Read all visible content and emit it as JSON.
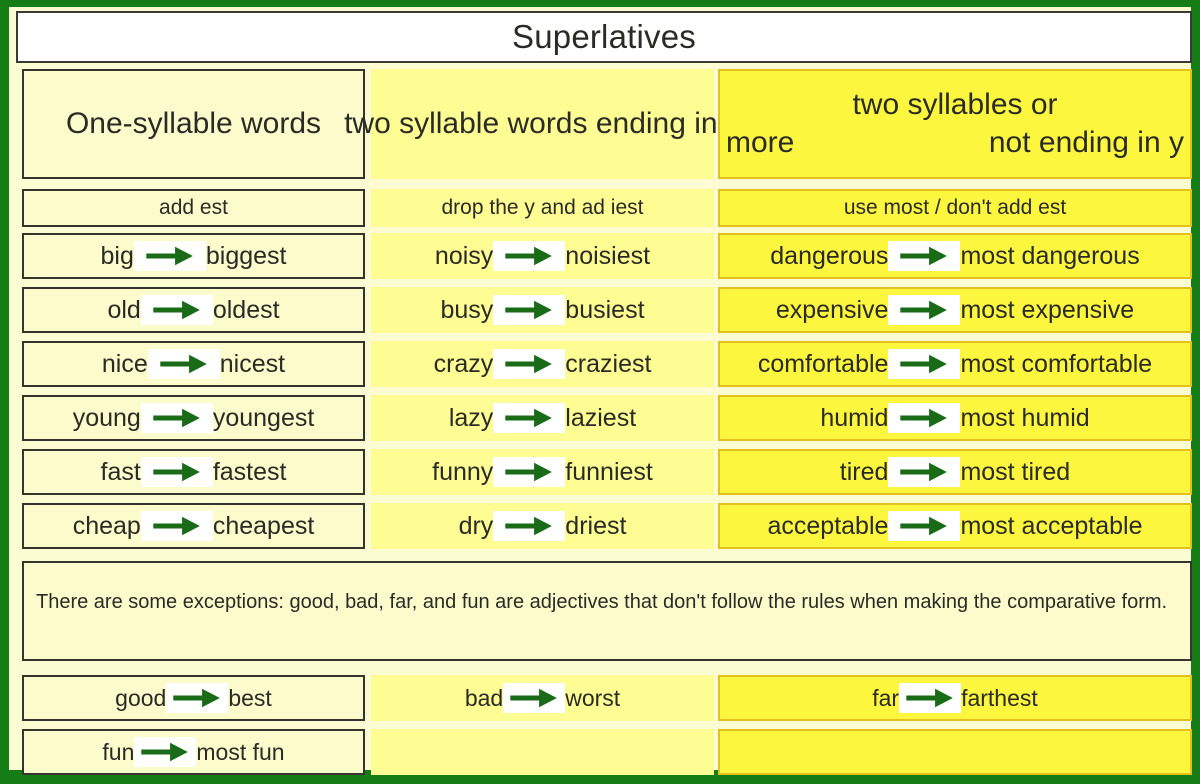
{
  "title": "Superlatives",
  "columns": [
    {
      "header": "One-syllable words",
      "rule": "add est"
    },
    {
      "header": "two syllable words ending in y",
      "rule": "drop the y and ad iest"
    },
    {
      "header_line1": "two syllables or",
      "header_line2_left": "more",
      "header_line2_right": "not ending in y",
      "rule": "use most / don't add est"
    }
  ],
  "rows": [
    {
      "col1": {
        "base": "big",
        "super": "biggest"
      },
      "col2": {
        "base": "noisy",
        "super": "noisiest"
      },
      "col3": {
        "base": "dangerous",
        "super": "most dangerous"
      }
    },
    {
      "col1": {
        "base": "old",
        "super": "oldest"
      },
      "col2": {
        "base": "busy",
        "super": "busiest"
      },
      "col3": {
        "base": "expensive",
        "super": "most expensive"
      }
    },
    {
      "col1": {
        "base": "nice",
        "super": "nicest"
      },
      "col2": {
        "base": "crazy",
        "super": "craziest"
      },
      "col3": {
        "base": "comfortable",
        "super": "most comfortable"
      }
    },
    {
      "col1": {
        "base": "young",
        "super": "youngest"
      },
      "col2": {
        "base": "lazy",
        "super": "laziest"
      },
      "col3": {
        "base": "humid",
        "super": "most humid"
      }
    },
    {
      "col1": {
        "base": "fast",
        "super": "fastest"
      },
      "col2": {
        "base": "funny",
        "super": "funniest"
      },
      "col3": {
        "base": "tired",
        "super": "most tired"
      }
    },
    {
      "col1": {
        "base": "cheap",
        "super": "cheapest"
      },
      "col2": {
        "base": "dry",
        "super": "driest"
      },
      "col3": {
        "base": "acceptable",
        "super": "most acceptable"
      }
    }
  ],
  "note": "There are some exceptions: good, bad, far, and fun are adjectives that don't follow the rules when making the comparative form.",
  "exceptions": [
    {
      "col1": {
        "base": "good",
        "super": "best"
      },
      "col2": {
        "base": "bad",
        "super": "worst"
      },
      "col3": {
        "base": "far",
        "super": "farthest"
      }
    },
    {
      "col1": {
        "base": "fun",
        "super": "most fun"
      },
      "col2": {
        "base": "",
        "super": ""
      },
      "col3": {
        "base": "",
        "super": ""
      }
    }
  ],
  "icons": {
    "arrow": "arrow-right-icon"
  },
  "colors": {
    "frame_green": "#157d16",
    "arrow_green": "#1a6b18",
    "col1_bg": "#fbfbcc",
    "col2_bg": "#fdfd93",
    "col3_bg": "#fcf63f",
    "col1_border": "#35352d",
    "col3_border": "#e3c01c",
    "title_bg": "#ffffff",
    "text": "#2b2b26"
  }
}
